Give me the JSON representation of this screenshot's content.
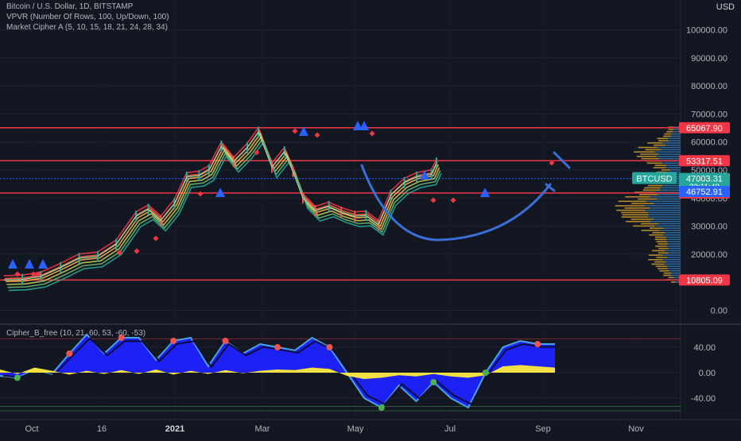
{
  "legend": {
    "title": "Bitcoin / U.S. Dollar, 1D, BITSTAMP",
    "vpvr": "VPVR (Number Of Rows, 100, Up/Down, 100)",
    "cipher_a": "Market Cipher A (5, 10, 15, 18, 21, 24, 28, 34)",
    "cipher_b": "Cipher_B_free (10, 21, 60, 53, -60, -53)"
  },
  "axis": {
    "currency": "USD",
    "price_ticks": [
      "100000.00",
      "90000.00",
      "80000.00",
      "70000.00",
      "60000.00",
      "50000.00",
      "40000.00",
      "30000.00",
      "20000.00",
      "0.00"
    ],
    "osc_ticks": [
      "40.00",
      "0.00",
      "-40.00"
    ],
    "time_ticks": [
      "Oct",
      "16",
      "2021",
      "Mar",
      "May",
      "Jul",
      "Sep",
      "Nov"
    ]
  },
  "badges": {
    "r1": "65067.90",
    "r2": "53317.51",
    "symbol": "BTCUSD",
    "last": "47003.31",
    "countdown": "23:11:48",
    "s1": "46752.91",
    "s2": "41802.96",
    "s3": "10805.09"
  },
  "colors": {
    "background": "#131722",
    "resistance": "#f23645",
    "last_price": "#26a69a",
    "blue_badge": "#2962ff",
    "cup_line": "#3b6fd8",
    "wave_fill": "#1e22ff",
    "money_flow": "#ffeb3b",
    "signal_up": "#2962ff",
    "signal_down": "#f23645"
  },
  "chart_data": {
    "type": "line",
    "title": "Bitcoin / U.S. Dollar, 1D, BITSTAMP",
    "ylim": [
      0,
      100000
    ],
    "horizontal_levels": [
      65067.9,
      53317.51,
      41802.96,
      10805.09
    ],
    "last_price": 47003.31,
    "secondary_level": 46752.91,
    "series": [
      {
        "dates": [
          "2020-09-20",
          "2020-10-05",
          "2020-10-20",
          "2020-11-05",
          "2020-11-20",
          "2020-12-05",
          "2020-12-20",
          "2021-01-05",
          "2021-01-15",
          "2021-01-25",
          "2021-02-05",
          "2021-02-15",
          "2021-02-25",
          "2021-03-05",
          "2021-03-15",
          "2021-03-25",
          "2021-04-05",
          "2021-04-14",
          "2021-04-25",
          "2021-05-05",
          "2021-05-12",
          "2021-05-20",
          "2021-05-30",
          "2021-06-10",
          "2021-06-20",
          "2021-07-01",
          "2021-07-10",
          "2021-07-20",
          "2021-07-30",
          "2021-08-10",
          "2021-08-20",
          "2021-09-01",
          "2021-09-05"
        ],
        "close": [
          10800,
          11000,
          12000,
          15200,
          18500,
          19200,
          23500,
          33500,
          36000,
          32000,
          38000,
          47500,
          48000,
          50000,
          58500,
          53000,
          58000,
          63500,
          51000,
          56500,
          49500,
          40000,
          35500,
          37000,
          35000,
          33500,
          33800,
          30500,
          41000,
          45500,
          47500,
          48500,
          52500
        ]
      }
    ],
    "oscillator": {
      "name": "Cipher_B_free (10, 21, 60, 53, -60, -53)",
      "ylim": [
        -60,
        60
      ],
      "wave": [
        -5,
        -8,
        5,
        -2,
        30,
        60,
        30,
        55,
        55,
        20,
        50,
        55,
        10,
        50,
        30,
        45,
        40,
        35,
        55,
        40,
        0,
        -40,
        -55,
        -20,
        -45,
        -15,
        -40,
        -55,
        0,
        40,
        50,
        45,
        45
      ],
      "money_flow": [
        5,
        -2,
        8,
        3,
        -3,
        3,
        -2,
        4,
        -2,
        5,
        -3,
        3,
        -2,
        4,
        -1,
        3,
        5,
        4,
        8,
        6,
        -5,
        -10,
        -8,
        -4,
        -6,
        -2,
        -6,
        -8,
        -4,
        10,
        12,
        10,
        8
      ]
    }
  }
}
